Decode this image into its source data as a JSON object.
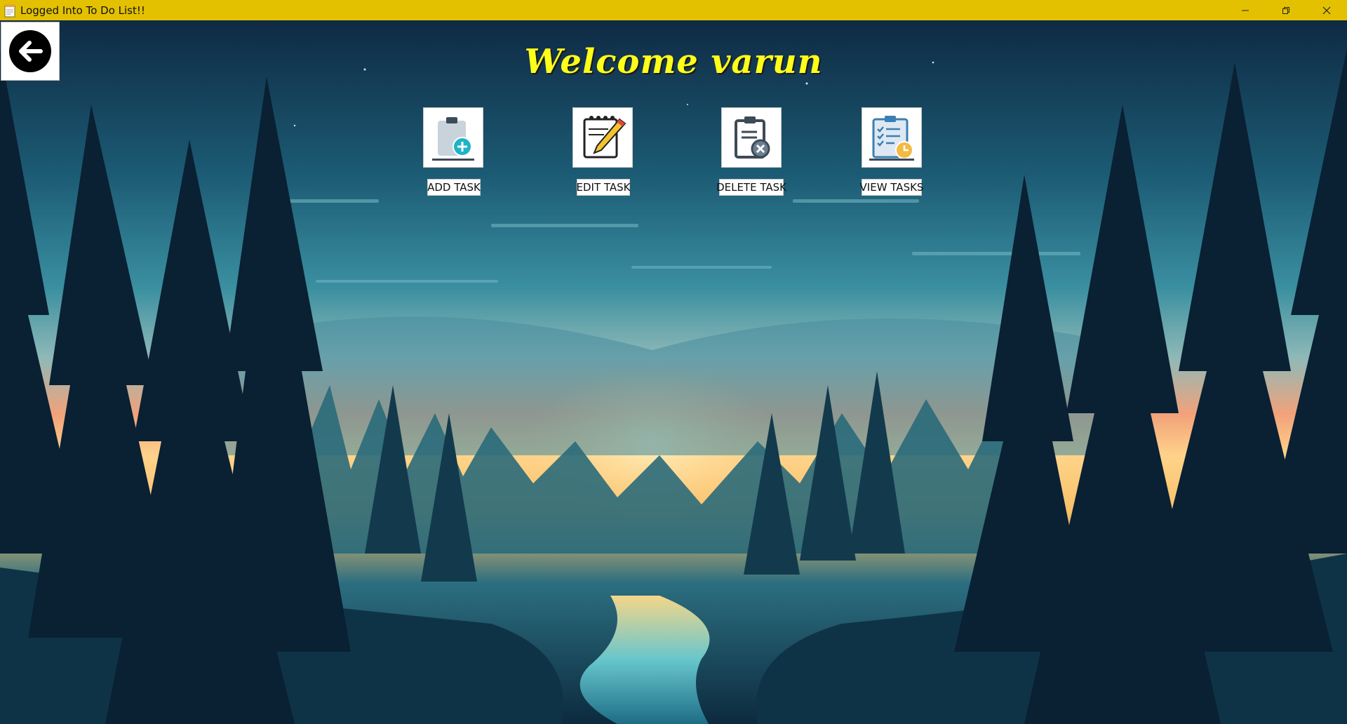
{
  "window": {
    "title": "Logged Into To Do List!!",
    "icon": "notepad-icon",
    "controls": [
      "minimize-icon",
      "restore-icon",
      "close-icon"
    ]
  },
  "header": {
    "back_icon": "arrow-left-icon",
    "welcome": "Welcome varun"
  },
  "actions": [
    {
      "label": "ADD TASK",
      "icon": "clipboard-add-icon"
    },
    {
      "label": "EDIT TASK",
      "icon": "notepad-pencil-icon"
    },
    {
      "label": "DELETE TASK",
      "icon": "clipboard-delete-icon"
    },
    {
      "label": "VIEW TASKS",
      "icon": "clipboard-checklist-clock-icon"
    }
  ],
  "colors": {
    "titlebar": "#e4c100",
    "welcome_text": "#ffff1a",
    "accent_teal": "#1fb3c8"
  }
}
